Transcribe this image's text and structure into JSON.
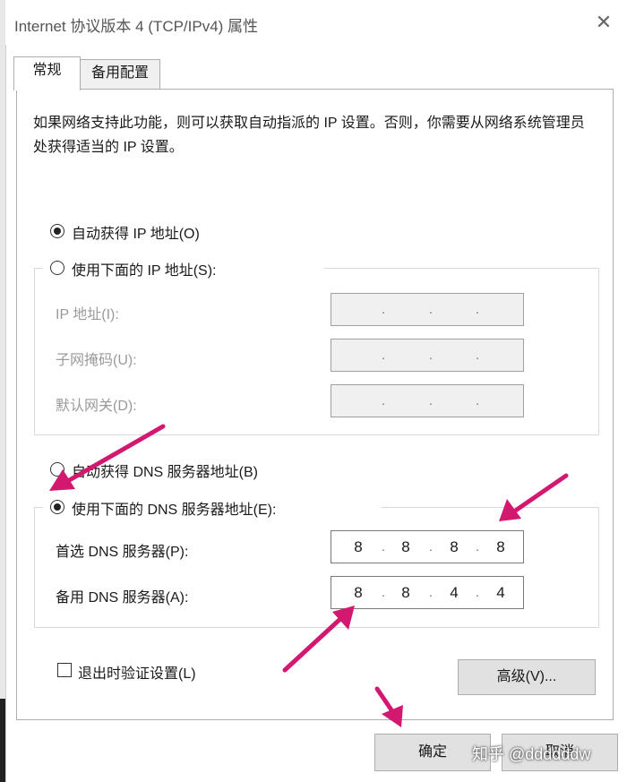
{
  "window": {
    "title": "Internet 协议版本 4 (TCP/IPv4) 属性",
    "close_glyph": "✕"
  },
  "tabs": [
    {
      "label": "常规"
    },
    {
      "label": "备用配置"
    }
  ],
  "description": "如果网络支持此功能，则可以获取自动指派的 IP 设置。否则，你需要从网络系统管理员处获得适当的 IP 设置。",
  "ip": {
    "auto_label": "自动获得 IP 地址(O)",
    "manual_label": "使用下面的 IP 地址(S):",
    "fields": [
      {
        "label": "IP 地址(I):",
        "octets": [
          "",
          "",
          "",
          ""
        ]
      },
      {
        "label": "子网掩码(U):",
        "octets": [
          "",
          "",
          "",
          ""
        ]
      },
      {
        "label": "默认网关(D):",
        "octets": [
          "",
          "",
          "",
          ""
        ]
      }
    ]
  },
  "dns": {
    "auto_label": "自动获得 DNS 服务器地址(B)",
    "manual_label": "使用下面的 DNS 服务器地址(E):",
    "fields": [
      {
        "label": "首选 DNS 服务器(P):",
        "octets": [
          "8",
          "8",
          "8",
          "8"
        ]
      },
      {
        "label": "备用 DNS 服务器(A):",
        "octets": [
          "8",
          "8",
          "4",
          "4"
        ]
      }
    ]
  },
  "validate_label": "退出时验证设置(L)",
  "advanced_label": "高级(V)...",
  "ok_label": "确定",
  "cancel_label": "取消",
  "watermark": "知乎 @ddddddw",
  "colors": {
    "arrow": "#d3186f",
    "panel_border": "#adadad",
    "button_face": "#e1e1e1"
  }
}
